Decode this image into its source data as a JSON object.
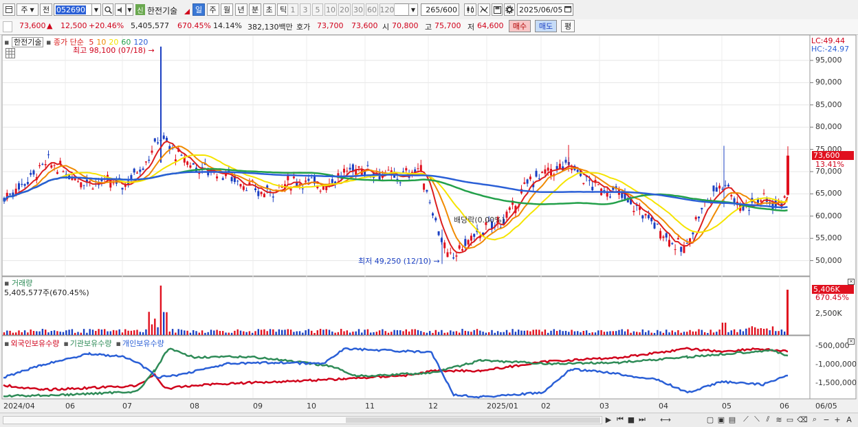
{
  "toolbar": {
    "market_tab": "주",
    "prev_label": "전",
    "stock_code": "052690",
    "credit_badge": "신",
    "stock_name": "한전기술",
    "period_tabs": [
      "일",
      "주",
      "월",
      "년",
      "분",
      "초",
      "틱"
    ],
    "active_period": "일",
    "interval_buttons": [
      "1",
      "3",
      "5",
      "10",
      "20",
      "30",
      "60",
      "120"
    ],
    "count_value": "265",
    "count_total": "/600",
    "date_value": "2025/06/05"
  },
  "quote": {
    "price": "73,600",
    "change": "12,500",
    "change_pct": "+20.46%",
    "volume": "5,405,577",
    "volume_ratio": "670.45%",
    "turnover": "14.14%",
    "amount": "382,130백만",
    "ask_label": "호가",
    "ask": "73,700",
    "bid": "73,600",
    "open_label": "시",
    "open": "70,800",
    "high_label": "고",
    "high": "75,700",
    "low_label": "저",
    "low": "64,600",
    "buy_button": "매수",
    "sell_button": "매도",
    "eval_button": "평"
  },
  "price_panel": {
    "title_name": "한전기술",
    "title_ma": "종가 단순",
    "ma_periods": [
      "5",
      "10",
      "20",
      "60",
      "120"
    ],
    "ma_colors": [
      "#dc1e1e",
      "#f08a00",
      "#f5e400",
      "#23a04a",
      "#2a5fd6"
    ],
    "lc": "LC:49.44",
    "hc": "HC:-24.97",
    "y_ticks": [
      "95,000",
      "90,000",
      "85,000",
      "80,000",
      "75,000",
      "70,000",
      "65,000",
      "60,000",
      "55,000",
      "50,000"
    ],
    "current_price": "73,600",
    "current_pct": "13.41%",
    "high_annot": "최고 98,100 (07/18)",
    "low_annot": "최저 49,250 (12/10)",
    "dividend_annot": "배당락(0.00%)"
  },
  "volume_panel": {
    "title": "거래량",
    "value": "5,405,577주(670.45%)",
    "current": "5,406K",
    "current_pct": "670.45%",
    "y_ticks": [
      "2,500K"
    ]
  },
  "holdings_panel": {
    "series": [
      "외국인보유수량",
      "기관보유수량",
      "개인보유수량"
    ],
    "colors": [
      "#d0021b",
      "#2e8b57",
      "#2a5fd6"
    ],
    "y_ticks": [
      "-500,000",
      "-1,000,000",
      "-1,500,000"
    ]
  },
  "xaxis": {
    "labels": [
      "2024/04",
      "06",
      "07",
      "08",
      "09",
      "10",
      "11",
      "12",
      "2025/01",
      "02",
      "03",
      "04",
      "05",
      "06"
    ],
    "right_label": "06/05"
  }
}
